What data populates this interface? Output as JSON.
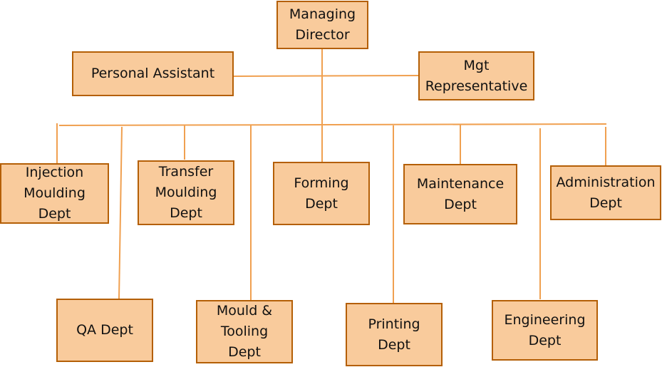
{
  "diagram": {
    "type": "org-chart",
    "colors": {
      "box_fill": "#f9cb9c",
      "box_border": "#b45f06",
      "connector": "#f0a050",
      "text": "#111111"
    },
    "top": {
      "id": "md",
      "label": "Managing\nDirector"
    },
    "staff": [
      {
        "id": "pa",
        "label": "Personal Assistant"
      },
      {
        "id": "mr",
        "label": "Mgt\nRepresentative"
      }
    ],
    "departments": [
      {
        "id": "inj",
        "label": "Injection\nMoulding\nDept"
      },
      {
        "id": "qa",
        "label": "QA Dept"
      },
      {
        "id": "trans",
        "label": "Transfer\nMoulding\nDept"
      },
      {
        "id": "mould",
        "label": "Mould &\nTooling\nDept"
      },
      {
        "id": "form",
        "label": "Forming\nDept"
      },
      {
        "id": "print",
        "label": "Printing\nDept"
      },
      {
        "id": "maint",
        "label": "Maintenance\nDept"
      },
      {
        "id": "eng",
        "label": "Engineering\nDept"
      },
      {
        "id": "admin",
        "label": "Administration\nDept"
      }
    ]
  }
}
